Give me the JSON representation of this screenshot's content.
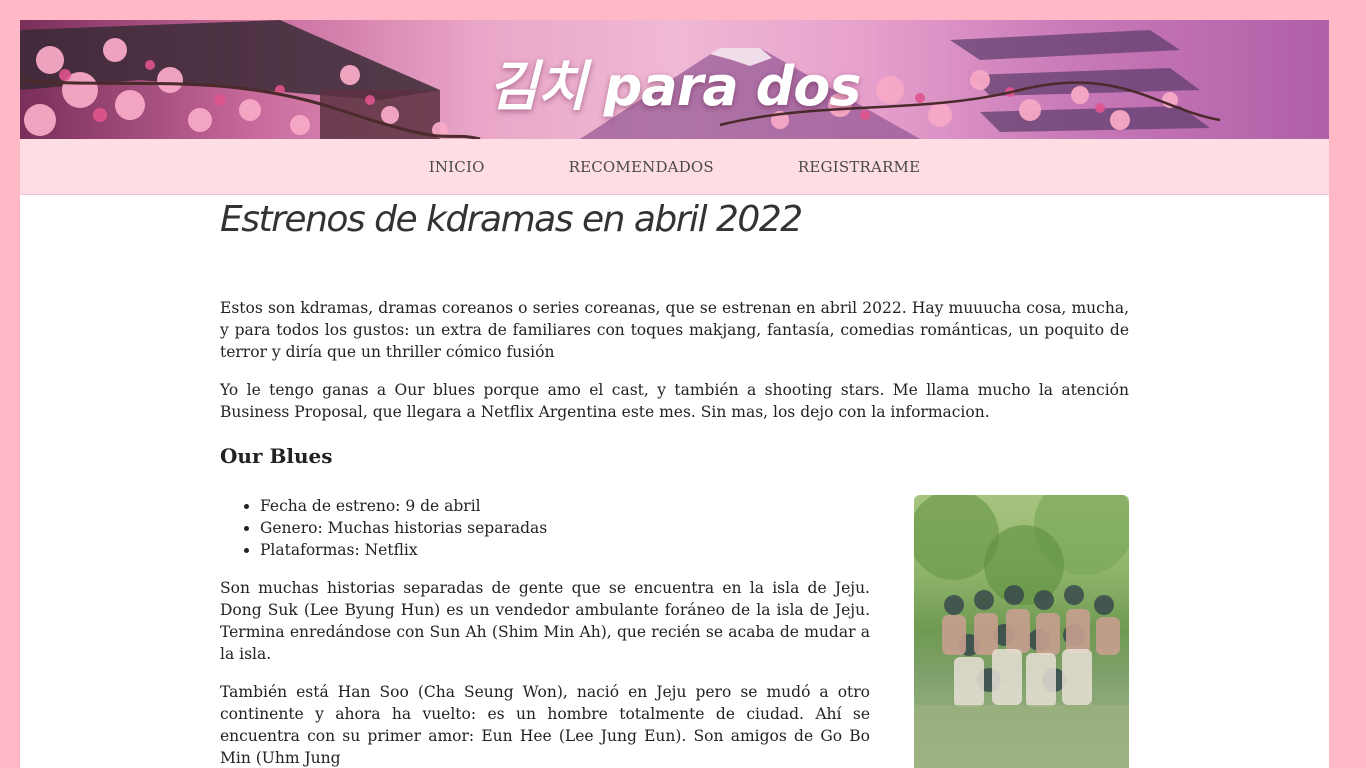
{
  "site": {
    "banner_title": "김치 para dos"
  },
  "nav": {
    "items": [
      "INICIO",
      "RECOMENDADOS",
      "REGISTRARME"
    ]
  },
  "article": {
    "title": "Estrenos de kdramas en abril 2022",
    "intro": [
      "Estos son kdramas, dramas coreanos o series coreanas, que se estrenan en abril 2022. Hay muuucha cosa, mucha, y para todos los gustos: un extra de familiares con toques makjang, fantasía, comedias románticas, un poquito de terror y diría que un thriller cómico fusión",
      "Yo le tengo ganas a Our blues porque amo el cast, y también a shooting stars. Me llama mucho la atención Business Proposal, que llegara a Netflix Argentina este mes. Sin mas, los dejo con la informacion."
    ],
    "dramas": [
      {
        "name": "Our Blues",
        "details": [
          "Fecha de estreno: 9 de abril",
          "Genero: Muchas historias separadas",
          "Plataformas: Netflix"
        ],
        "paragraphs": [
          "Son muchas historias separadas de gente que se encuentra en la isla de Jeju. Dong Suk (Lee Byung Hun) es un vendedor ambulante foráneo de la isla de Jeju. Termina enredándose con Sun Ah (Shim Min Ah), que recién se acaba de mudar a la isla.",
          "También está Han Soo (Cha Seung Won), nació en Jeju pero se mudó a otro continente y ahora ha vuelto: es un hombre totalmente de ciudad. Ahí se encuentra con su primer amor: Eun Hee (Lee Jung Eun). Son amigos de Go Bo Min (Uhm Jung"
        ]
      }
    ]
  },
  "colors": {
    "background": "#ffb9c6",
    "nav_background": "#ffdde4"
  }
}
